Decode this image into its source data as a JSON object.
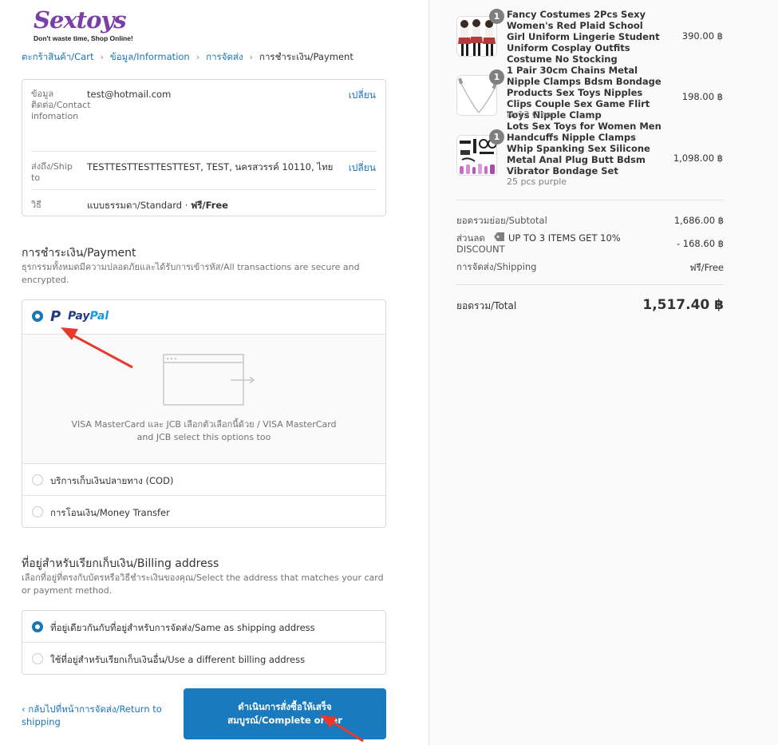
{
  "logo": {
    "word": "Sextoys",
    "tagline": "Don't waste time, Shop Online!"
  },
  "breadcrumb": {
    "cart": "ตะกร้าสินค้า/Cart",
    "information": "ข้อมูล/Information",
    "shipping": "การจัดส่ง",
    "payment": "การชำระเงิน/Payment",
    "separator": "›"
  },
  "review": {
    "contact": {
      "label": "ข้อมูลติดต่อ/Contact infomation",
      "value": "test@hotmail.com",
      "change": "เปลี่ยน"
    },
    "ship_to": {
      "label": "ส่งถึง/Ship to",
      "value": "TESTTESTTESTTESTTEST, TEST, นครสวรรค์ 10110, ไทย",
      "change": "เปลี่ยน"
    },
    "method": {
      "label": "วิธี",
      "value": "แบบธรรมดา/Standard · ",
      "value_bold": "ฟรี/Free"
    }
  },
  "payment": {
    "title": "การชำระเงิน/Payment",
    "subtitle": "ธุรกรรมทั้งหมดมีความปลอดภัยและได้รับการเข้ารหัส/All transactions are secure and encrypted.",
    "paypal": {
      "mark": "P",
      "word_a": "Pay",
      "word_b": "Pal",
      "selected": true
    },
    "paypal_detail": "VISA MasterCard และ JCB เลือกตัวเลือกนี้ด้วย / VISA MasterCard and JCB select this options too",
    "cod": {
      "label": "บริการเก็บเงินปลายทาง (COD)",
      "selected": false
    },
    "transfer": {
      "label": "การโอนเงิน/Money Transfer",
      "selected": false
    }
  },
  "billing": {
    "title": "ที่อยู่สำหรับเรียกเก็บเงิน/Billing address",
    "subtitle": "เลือกที่อยู่ที่ตรงกับบัตรหรือวิธีชำระเงินของคุณ/Select the address that matches your card or payment method.",
    "same": {
      "label": "ที่อยู่เดียวกันกับที่อยู่สำหรับการจัดส่ง/Same as shipping address",
      "selected": true
    },
    "different": {
      "label": "ใช้ที่อยู่สำหรับเรียกเก็บเงินอื่น/Use a different billing address",
      "selected": false
    }
  },
  "footer": {
    "return_link": "‹ กลับไปที่หน้าการจัดส่ง/Return to shipping",
    "complete_button": "ดำเนินการสั่งซื้อให้เสร็จสมบูรณ์/Complete order"
  },
  "products": [
    {
      "qty": "1",
      "title": "Fancy Costumes 2Pcs Sexy Women's Red Plaid School Girl Uniform Lingerie Student Uniform Cosplay Outfits Costume No Stocking",
      "variant": "",
      "price": "390.00 ฿",
      "thumb_icon": "costume-thumbnail"
    },
    {
      "qty": "1",
      "title": "1 Pair 30cm Chains Metal Nipple Clamps Bdsm Bondage Products Sex Toys Nipples Clips Couple Sex Game Flirt Toys Nipple Clamp",
      "variant": "Nc13 Clear",
      "price": "198.00 ฿",
      "thumb_icon": "chain-clamp-thumbnail"
    },
    {
      "qty": "1",
      "title": "Lots Sex Toys for Women Men Handcuffs Nipple Clamps Whip Spanking Sex Silicone Metal Anal Plug Butt Bdsm Vibrator Bondage Set",
      "variant": "25 pcs purple",
      "price": "1,098.00 ฿",
      "thumb_icon": "toy-set-thumbnail"
    }
  ],
  "totals": {
    "subtotal_label": "ยอดรวมย่อย/Subtotal",
    "subtotal_value": "1,686.00 ฿",
    "discount_label": "ส่วนลด DISCOUNT",
    "discount_code": "UP TO 3 ITEMS GET 10%",
    "discount_value": "- 168.60 ฿",
    "shipping_label": "การจัดส่ง/Shipping",
    "shipping_value": "ฟรี/Free",
    "total_label": "ยอดรวม/Total",
    "total_value": "1,517.40 ฿"
  },
  "colors": {
    "accent": "#197bbd",
    "link": "#1a75b5",
    "brand": "#7a3fa8",
    "annotation_arrow": "#e8392f"
  }
}
